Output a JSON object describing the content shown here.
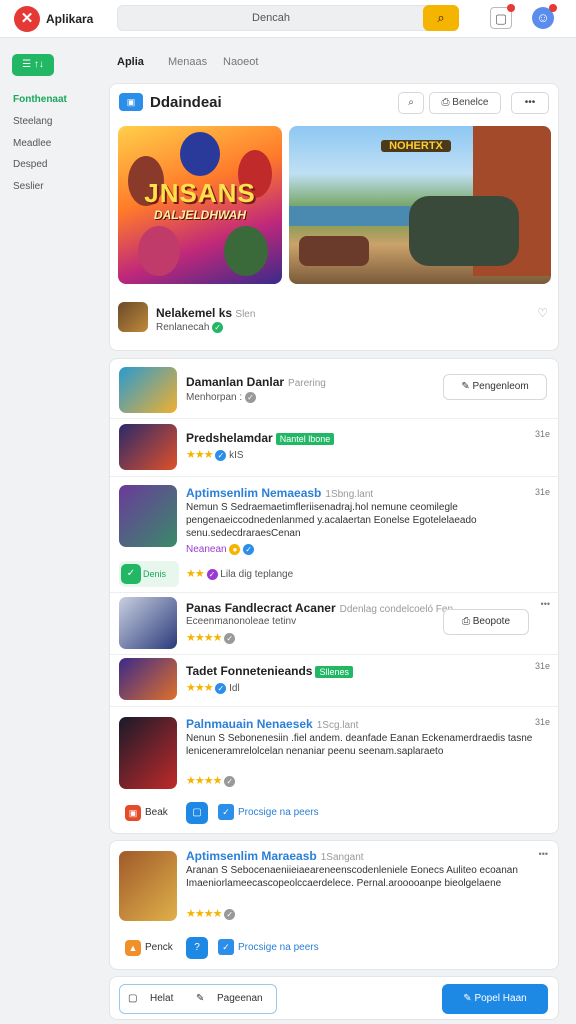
{
  "header": {
    "brand": "Aplikara",
    "search_placeholder": "Dencah",
    "search_icon": "search-icon",
    "calendar_icon": "calendar-icon",
    "avatar_icon": "avatar-icon"
  },
  "sidebar": {
    "menu_label": "☰ ↑↓",
    "items": [
      {
        "label": "Fonthenaat",
        "active": true
      },
      {
        "label": "Steelang",
        "active": false
      },
      {
        "label": "Meadlee",
        "active": false
      },
      {
        "label": "Desped",
        "active": false
      },
      {
        "label": "Seslier",
        "active": false
      }
    ]
  },
  "tabs": [
    {
      "label": "Aplia",
      "active": true
    },
    {
      "label": "Menaas",
      "active": false
    },
    {
      "label": "Naoeot",
      "active": false
    }
  ],
  "featured": {
    "badge": "▣",
    "title": "Ddaindeai",
    "search_btn": "⌕",
    "filter_btn": "⎙ Benelce",
    "more_btn": "•••",
    "banner1_title": "JNSANS",
    "banner1_sub": "DALJELDHWAH",
    "banner2_title": "NOHERTX",
    "app_name": "Nelakemel ks",
    "app_name_muted": "Slen",
    "app_sub": "Renlanecah"
  },
  "list": {
    "rows": [
      {
        "name": "Damanlan Danlar",
        "muted": "Parering",
        "sub": "Menhorpan :",
        "button": "✎ Pengenleom"
      },
      {
        "name": "Predshelamdar",
        "tag": "Nantel lbone",
        "rating": "★★★",
        "reviews": "kIS",
        "meta": "31e"
      },
      {
        "name": "Aptimsenlim Nemaeasb",
        "muted": "1Sbng.lant",
        "desc": "Nemun S Sedraemaetimfleriisenadraj.hol nemune ceomilegle pengenaeiccodnedenlanmed y.acalaertan Eonelse Egotelelaeado senu.sedecdraraesCenan",
        "sub2": "Neanean",
        "rating": "★★",
        "rating_text": "Lila dig teplange",
        "action": "Denis",
        "meta": "31e"
      },
      {
        "name": "Panas Fandlecract Acaner",
        "muted": "Ddenlag condelcoeló Fen",
        "sub": "Eceenmanonoleae tetinv",
        "rating": "★★★★",
        "button": "⎙ Beopote",
        "meta": "•••"
      },
      {
        "name": "Tadet Fonnetenieands",
        "tag": "Sllenes",
        "rating": "★★★",
        "reviews": "Idl",
        "meta": "31e"
      },
      {
        "name": "Palnmauain Nenaesek",
        "muted": "1Scg.lant",
        "desc": "Nenun S Sebonenesiin .fiel andem. deanfade Eanan Eckenamerdraedis tasne leniceneramrelolcelan nenaniar peenu seenam.saplaraeto",
        "rating": "★★★★",
        "action1": "Beak",
        "action3": "Procsige na peers",
        "meta": "31e"
      }
    ]
  },
  "card3": {
    "name": "Aptimsenlim Maraeasb",
    "muted": "1Sangant",
    "desc": "Aranan S Sebocenaeniieiaeareneenscodenleniele Eonecs Auliteo ecoanan Imaeniorlameecascopeolccaerdelece. Pernal.arooooanpe bieolgelaene",
    "rating": "★★★★",
    "action1": "Penck",
    "action3": "Procsige na peers",
    "meta": "•••"
  },
  "bottom": {
    "left1": "Helat",
    "left2": "Pageenan",
    "cta": "Popel Haan"
  }
}
